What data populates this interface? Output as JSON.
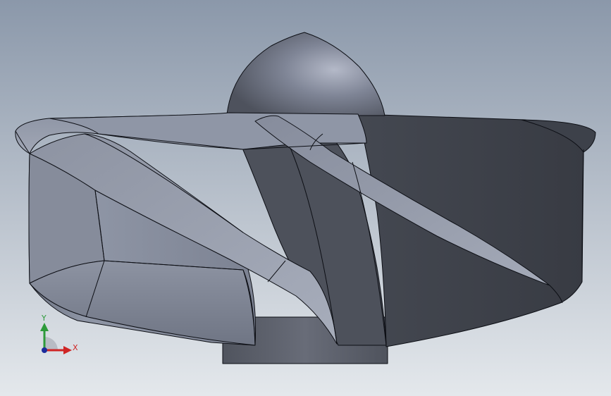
{
  "viewport": {
    "background_top": "#8b98aa",
    "background_bottom": "#e4e8ec"
  },
  "model": {
    "edge_color": "#0c0e14",
    "light_face": "#9aa0ae",
    "mid_face": "#6f7584",
    "dark_face": "#3c4049"
  },
  "triad": {
    "y_label": "Y",
    "x_label": "X",
    "y_color": "#2d9a3a",
    "x_color": "#cf2525",
    "z_color": "#1c2c9c"
  }
}
